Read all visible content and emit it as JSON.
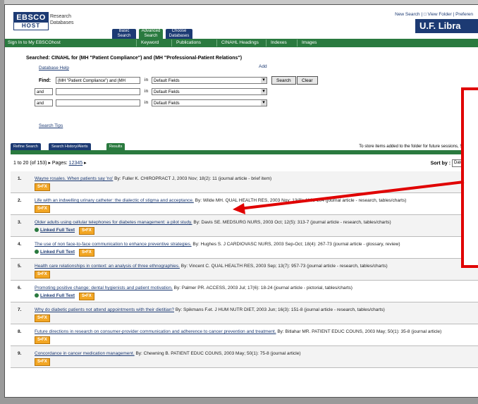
{
  "header": {
    "logo_top": "EBSCO",
    "logo_bottom": "HOST",
    "brand_line1": "Research",
    "brand_line2": "Databases",
    "tabs": [
      "Basic Search",
      "Advanced Search",
      "Choose Databases"
    ],
    "top_links": "New Search | □ View Folder | Preferen",
    "library": "U.F. Libra"
  },
  "navbar": {
    "sign_in": "Sign In to My EBSCOhost",
    "items": [
      "Keyword",
      "Publications",
      "CINAHL Headings",
      "Indexes",
      "Images"
    ]
  },
  "search": {
    "searched_label": "Searched:",
    "searched_query": "CINAHL for (MH \"Patient Compliance\") and (MH \"Professional-Patient Relations\")",
    "add_link": "Add",
    "database_help": "Database Help",
    "find_label": "Find:",
    "row1_value": "(MH \"Patient Compliance\") and (MH",
    "in_label": "in",
    "default_field": "Default Fields",
    "and_label": "and",
    "search_button": "Search",
    "clear_button": "Clear",
    "reset_link": "Search Tips"
  },
  "results_tabs": [
    "Refine Search",
    "Search History/Alerts",
    "Results"
  ],
  "obtain_note": "To store items added to the folder for future sessions, Sign In",
  "pager": {
    "range": "1 to 20 (of 153)",
    "pages_label": "Pages:",
    "pages": [
      "1",
      "2",
      "3",
      "4",
      "5"
    ],
    "next": "▸"
  },
  "sort": {
    "label": "Sort by :",
    "value": "Date"
  },
  "results": [
    {
      "num": "1.",
      "title": "Wayne rosales. When patients say 'no'",
      "meta": "By: Fuller K. CHIROPRACT J, 2003 Nov; 18(2): 11 (journal article - brief item)",
      "fulltext": "",
      "sfx": "S•FX"
    },
    {
      "num": "2.",
      "title": "Life with an indwelling urinary catheter: the dialectic of stigma and acceptance.",
      "meta": "By: Wilde MH. QUAL HEALTH RES, 2003 Nov; 13(9): 1189-204 (journal article - research, tables/charts)",
      "fulltext": "",
      "sfx": "S•FX"
    },
    {
      "num": "3.",
      "title": "Older adults using cellular telephones for diabetes management: a pilot study.",
      "meta": "By: Davis SE. MEDSURG NURS, 2003 Oct; 12(5): 313-7 (journal article - research, tables/charts)",
      "fulltext": "Linked Full Text",
      "sfx": "S•FX"
    },
    {
      "num": "4.",
      "title": "The use of non face-to-face communication to enhance preventive strategies.",
      "meta": "By: Hughes S. J CARDIOVASC NURS, 2003 Sep-Oct; 18(4): 267-73 (journal article - glossary, review)",
      "fulltext": "Linked Full Text",
      "sfx": "S•FX"
    },
    {
      "num": "5.",
      "title": "Health care relationships in context: an analysis of three ethnographies.",
      "meta": "By: Vincent C. QUAL HEALTH RES, 2003 Sep; 13(7): 957-73 (journal article - research, tables/charts)",
      "fulltext": "",
      "sfx": "S•FX"
    },
    {
      "num": "6.",
      "title": "Promoting positive change: dental hygienists and patient motivation.",
      "meta": "By: Palmer PR. ACCESS, 2003 Jul; 17(6): 18-24 (journal article - pictorial, tables/charts)",
      "fulltext": "Linked Full Text",
      "sfx": "S•FX"
    },
    {
      "num": "7.",
      "title": "Why do diabetic patients not attend appointments with their dietitian?",
      "meta": "By: Spikmans F.et. J HUM NUTR DIET, 2003 Jun; 16(3): 151-8 (journal article - research, tables/charts)",
      "fulltext": "",
      "sfx": "S•FX"
    },
    {
      "num": "8.",
      "title": "Future directions in research on consumer-provider communication and adherence to cancer prevention and treatment.",
      "meta": "By: Bitlahar MR. PATIENT EDUC COUNS, 2003 May; 50(1): 35-8 (journal article)",
      "fulltext": "",
      "sfx": "S•FX"
    },
    {
      "num": "9.",
      "title": "Concordance in cancer medication management.",
      "meta": "By: Chewning B. PATIENT EDUC COUNS, 2003 May; 50(1): 75-8 (journal article)",
      "fulltext": "",
      "sfx": "S•FX"
    }
  ],
  "colors": {
    "accent_red": "#e00000",
    "ebsco_blue": "#1c3a73",
    "green": "#2a7a3f"
  }
}
